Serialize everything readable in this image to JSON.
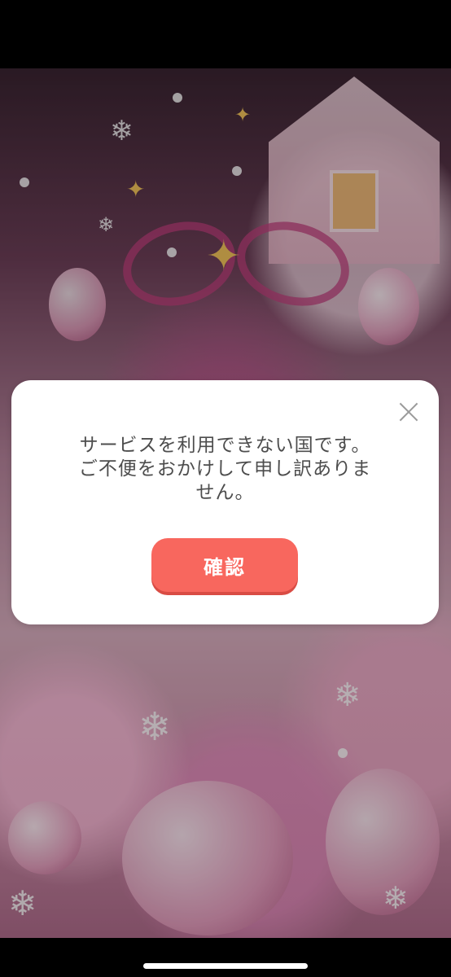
{
  "dialog": {
    "message_lines": [
      "サービスを利用できない国です。",
      "ご不便をおかけして申し訳ありま",
      "せん。"
    ],
    "confirm_label": "確認",
    "close_icon": "close-icon",
    "accent_color": "#f8675e"
  },
  "background": {
    "theme": "pink Christmas game scene",
    "snowflake_glyph": "❄",
    "star_glyph": "✦"
  }
}
